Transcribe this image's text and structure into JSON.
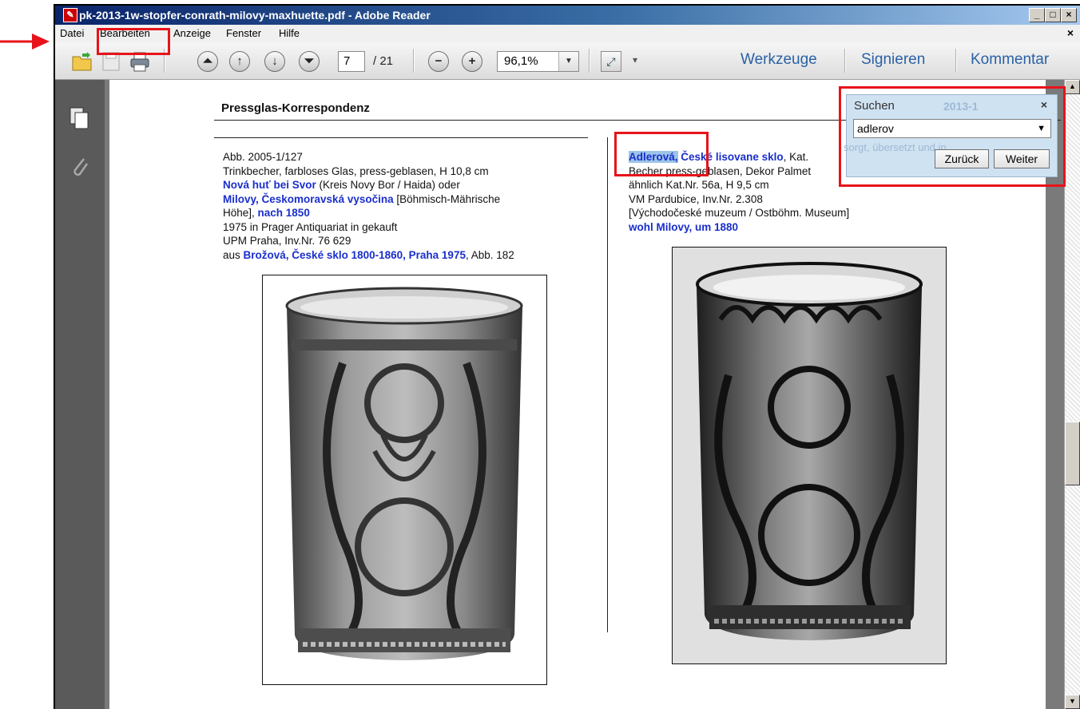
{
  "window": {
    "title": "pk-2013-1w-stopfer-conrath-milovy-maxhuette.pdf - Adobe Reader",
    "close_x": "×"
  },
  "menu": [
    "Datei",
    "Bearbeiten",
    "Anzeige",
    "Fenster",
    "Hilfe"
  ],
  "toolbar": {
    "page_current": "7",
    "page_total": "/ 21",
    "zoom": "96,1%",
    "links": [
      "Werkzeuge",
      "Signieren",
      "Kommentar"
    ]
  },
  "document": {
    "header": "Pressglas-Korrespondenz",
    "left_caption": [
      {
        "plain": "Abb. 2005-1/127"
      },
      {
        "plain": "Trinkbecher, farbloses Glas, press-geblasen, H 10,8 cm"
      },
      {
        "bold": "Nová huť bei Svor",
        "after": " (Kreis Novy Bor / Haida) oder"
      },
      {
        "bold": "Milovy, Českomoravská vysočina",
        "after": " [Böhmisch-Mährische"
      },
      {
        "plain": "Höhe], ",
        "bold2": "nach 1850"
      },
      {
        "plain": "1975 in Prager Antiquariat in gekauft"
      },
      {
        "plain": "UPM Praha, Inv.Nr. 76 629"
      },
      {
        "plain": "aus ",
        "bold2": "Brožová, České sklo 1800-1860, Praha 1975",
        "after2": ", Abb. 182"
      }
    ],
    "right_caption": {
      "highlight": "Adlerová,",
      "line1_bold": " České lisovane sklo",
      "line1_rest": ", Kat.",
      "line2": "Becher press-geblasen, Dekor Palmet",
      "line3": "ähnlich Kat.Nr. 56a, H 9,5 cm",
      "line4": "VM Pardubice, Inv.Nr. 2.308",
      "line5": "[Východočeské muzeum / Ostböhm. Museum]",
      "line6": "wohl Milovy, um 1880"
    }
  },
  "search": {
    "title": "Suchen",
    "bg_label": "2013-1",
    "bg_text": "sorgt, übersetzt und in",
    "query": "adlerov",
    "back": "Zurück",
    "next": "Weiter",
    "close": "×"
  },
  "annotation_color": "#e8131a"
}
